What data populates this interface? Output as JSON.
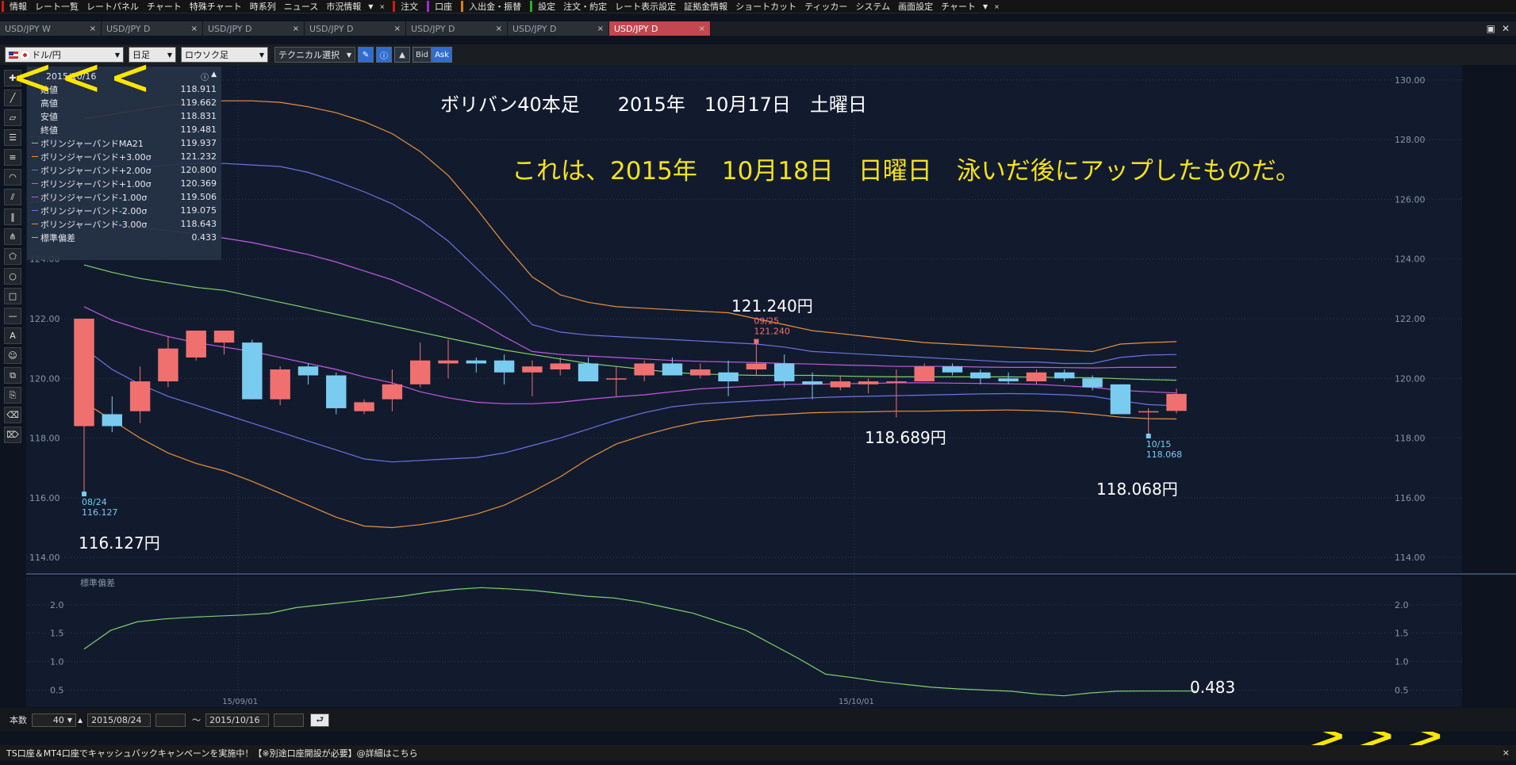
{
  "menubar": {
    "items": [
      "情報",
      "レート一覧",
      "レートパネル",
      "チャート",
      "特殊チャート",
      "時系列",
      "ニュース",
      "市況情報",
      "▼",
      "×",
      "注文",
      "口座",
      "入出金・振替",
      "設定",
      "注文・約定",
      "レート表示設定",
      "証拠金情報",
      "ショートカット",
      "ティッカー",
      "システム",
      "画面設定",
      "チャート",
      "▼",
      "×"
    ],
    "accent_colors": [
      "#d01a1a",
      "#9b2fd0",
      "#e07a1a",
      "#25b02a",
      "#e07a1a"
    ]
  },
  "tabs": [
    {
      "label": "USD/JPY W"
    },
    {
      "label": "USD/JPY D"
    },
    {
      "label": "USD/JPY D"
    },
    {
      "label": "USD/JPY D"
    },
    {
      "label": "USD/JPY D"
    },
    {
      "label": "USD/JPY D"
    },
    {
      "label": "USD/JPY D",
      "active": true
    }
  ],
  "tab_close": "×",
  "window_buttons": {
    "maximize": "▣",
    "close": "✕"
  },
  "toolbar": {
    "currency_pair": "ドル/円",
    "timeframe": "日足",
    "chart_type": "ロウソク足",
    "technical": "テクニカル選択",
    "bid": "Bid",
    "ask": "Ask"
  },
  "info_panel": {
    "date": "2015/10/16",
    "rows": [
      {
        "label": "始値",
        "value": "118.911"
      },
      {
        "label": "高値",
        "value": "119.662"
      },
      {
        "label": "安値",
        "value": "118.831"
      },
      {
        "label": "終値",
        "value": "119.481"
      },
      {
        "label": "ボリンジャーバンドMA21",
        "value": "119.937",
        "color": "#7ed16c"
      },
      {
        "label": "ボリンジャーバンド+3.00σ",
        "value": "121.232",
        "color": "#e8913a"
      },
      {
        "label": "ボリンジャーバンド+2.00σ",
        "value": "120.800",
        "color": "#6b74e0"
      },
      {
        "label": "ボリンジャーバンド+1.00σ",
        "value": "120.369",
        "color": "#c15be0"
      },
      {
        "label": "ボリンジャーバンド-1.00σ",
        "value": "119.506",
        "color": "#c15be0"
      },
      {
        "label": "ボリンジャーバンド-2.00σ",
        "value": "119.075",
        "color": "#6b74e0"
      },
      {
        "label": "ボリンジャーバンド-3.00σ",
        "value": "118.643",
        "color": "#e8913a"
      },
      {
        "label": "標準偏差",
        "value": "0.433",
        "color": "#7ed16c"
      }
    ]
  },
  "annotations": {
    "title": "ボリバン40本足　　2015年　10月17日　土曜日",
    "note": "これは、2015年　10月18日　日曜日　泳いだ後にアップしたものだ。",
    "high_label": "121.240円",
    "mid_low_label": "118.689円",
    "recent_low_label": "118.068円",
    "low_label": "116.127円",
    "std_label": "0.483",
    "left_arrows": "<<<",
    "right_arrows": ">>>"
  },
  "markers": {
    "high_date": "09/25",
    "high_value": "121.240",
    "low_date": "08/24",
    "low_value": "116.127",
    "recent_low_date": "10/15",
    "recent_low_value": "118.068"
  },
  "chart_data": [
    {
      "type": "candlestick",
      "ylim": [
        113.5,
        130.5
      ],
      "y_ticks": [
        "130.00",
        "128.00",
        "126.00",
        "124.00",
        "122.00",
        "120.00",
        "118.00",
        "116.00",
        "114.00"
      ],
      "x_tick_labels": [
        "15/09/01",
        "15/10/01"
      ],
      "candles": [
        {
          "o": 118.4,
          "h": 122.0,
          "l": 116.13,
          "c": 122.0
        },
        {
          "o": 118.8,
          "h": 119.4,
          "l": 118.2,
          "c": 118.4
        },
        {
          "o": 118.9,
          "h": 120.4,
          "l": 118.5,
          "c": 119.9
        },
        {
          "o": 119.9,
          "h": 121.4,
          "l": 119.7,
          "c": 121.0
        },
        {
          "o": 120.7,
          "h": 121.6,
          "l": 120.6,
          "c": 121.6
        },
        {
          "o": 121.2,
          "h": 121.6,
          "l": 120.8,
          "c": 121.6
        },
        {
          "o": 121.2,
          "h": 121.3,
          "l": 119.3,
          "c": 119.3
        },
        {
          "o": 119.3,
          "h": 120.4,
          "l": 119.1,
          "c": 120.3
        },
        {
          "o": 120.4,
          "h": 120.5,
          "l": 119.8,
          "c": 120.1
        },
        {
          "o": 120.1,
          "h": 120.2,
          "l": 118.8,
          "c": 119.0
        },
        {
          "o": 118.9,
          "h": 119.3,
          "l": 118.8,
          "c": 119.2
        },
        {
          "o": 119.3,
          "h": 120.3,
          "l": 118.9,
          "c": 119.8
        },
        {
          "o": 119.8,
          "h": 121.2,
          "l": 119.7,
          "c": 120.6
        },
        {
          "o": 120.5,
          "h": 121.3,
          "l": 120.0,
          "c": 120.6
        },
        {
          "o": 120.6,
          "h": 120.7,
          "l": 120.2,
          "c": 120.5
        },
        {
          "o": 120.6,
          "h": 120.8,
          "l": 119.8,
          "c": 120.2
        },
        {
          "o": 120.2,
          "h": 120.6,
          "l": 119.4,
          "c": 120.4
        },
        {
          "o": 120.3,
          "h": 120.7,
          "l": 120.1,
          "c": 120.5
        },
        {
          "o": 120.5,
          "h": 120.7,
          "l": 119.9,
          "c": 119.9
        },
        {
          "o": 120.0,
          "h": 120.4,
          "l": 119.4,
          "c": 120.0
        },
        {
          "o": 120.1,
          "h": 120.6,
          "l": 119.9,
          "c": 120.5
        },
        {
          "o": 120.5,
          "h": 120.7,
          "l": 120.2,
          "c": 120.1
        },
        {
          "o": 120.1,
          "h": 120.5,
          "l": 120.0,
          "c": 120.3
        },
        {
          "o": 120.2,
          "h": 120.6,
          "l": 119.4,
          "c": 119.9
        },
        {
          "o": 120.3,
          "h": 121.24,
          "l": 120.1,
          "c": 120.5
        },
        {
          "o": 120.5,
          "h": 120.8,
          "l": 119.7,
          "c": 119.9
        },
        {
          "o": 119.9,
          "h": 120.2,
          "l": 119.3,
          "c": 119.8
        },
        {
          "o": 119.7,
          "h": 120.1,
          "l": 119.6,
          "c": 119.9
        },
        {
          "o": 119.8,
          "h": 120.0,
          "l": 119.5,
          "c": 119.9
        },
        {
          "o": 119.9,
          "h": 120.3,
          "l": 118.69,
          "c": 119.9
        },
        {
          "o": 119.9,
          "h": 120.5,
          "l": 119.9,
          "c": 120.4
        },
        {
          "o": 120.4,
          "h": 120.5,
          "l": 120.1,
          "c": 120.2
        },
        {
          "o": 120.2,
          "h": 120.3,
          "l": 119.8,
          "c": 120.0
        },
        {
          "o": 120.0,
          "h": 120.2,
          "l": 119.8,
          "c": 119.9
        },
        {
          "o": 119.9,
          "h": 120.3,
          "l": 119.8,
          "c": 120.2
        },
        {
          "o": 120.2,
          "h": 120.3,
          "l": 119.9,
          "c": 120.0
        },
        {
          "o": 120.0,
          "h": 120.1,
          "l": 119.6,
          "c": 119.7
        },
        {
          "o": 119.8,
          "h": 119.8,
          "l": 118.8,
          "c": 118.8
        },
        {
          "o": 118.9,
          "h": 119.0,
          "l": 118.07,
          "c": 118.9
        },
        {
          "o": 118.91,
          "h": 119.66,
          "l": 118.83,
          "c": 119.48
        }
      ],
      "bands": {
        "ma21": [
          123.8,
          123.55,
          123.35,
          123.2,
          123.05,
          122.95,
          122.75,
          122.55,
          122.35,
          122.15,
          121.95,
          121.75,
          121.55,
          121.35,
          121.15,
          120.95,
          120.8,
          120.65,
          120.5,
          120.4,
          120.3,
          120.2,
          120.15,
          120.12,
          120.1,
          120.1,
          120.1,
          120.08,
          120.06,
          120.05,
          120.05,
          120.05,
          120.05,
          120.05,
          120.04,
          120.03,
          120.02,
          119.99,
          119.96,
          119.94
        ],
        "p3": [
          128.7,
          128.85,
          129.0,
          129.15,
          129.25,
          129.3,
          129.3,
          129.25,
          129.1,
          128.9,
          128.6,
          128.2,
          127.6,
          126.8,
          125.7,
          124.5,
          123.4,
          122.8,
          122.55,
          122.4,
          122.35,
          122.3,
          122.25,
          122.2,
          122.0,
          121.8,
          121.6,
          121.5,
          121.4,
          121.3,
          121.2,
          121.15,
          121.1,
          121.05,
          121.0,
          120.95,
          120.9,
          121.15,
          121.2,
          121.23
        ],
        "p2": [
          126.85,
          126.95,
          127.05,
          127.15,
          127.2,
          127.2,
          127.15,
          127.1,
          126.9,
          126.6,
          126.25,
          125.85,
          125.3,
          124.6,
          123.7,
          122.8,
          121.8,
          121.55,
          121.45,
          121.4,
          121.35,
          121.3,
          121.25,
          121.2,
          121.15,
          121.05,
          120.9,
          120.85,
          120.8,
          120.75,
          120.7,
          120.65,
          120.6,
          120.55,
          120.55,
          120.5,
          120.5,
          120.7,
          120.78,
          120.8
        ],
        "p1": [
          125.25,
          125.15,
          125.05,
          124.95,
          124.85,
          124.7,
          124.55,
          124.35,
          124.15,
          123.9,
          123.6,
          123.3,
          122.9,
          122.45,
          121.95,
          121.4,
          120.9,
          120.8,
          120.75,
          120.7,
          120.65,
          120.6,
          120.57,
          120.55,
          120.53,
          120.5,
          120.48,
          120.45,
          120.43,
          120.4,
          120.4,
          120.4,
          120.38,
          120.37,
          120.37,
          120.36,
          120.35,
          120.37,
          120.37,
          120.37
        ],
        "m1": [
          122.4,
          121.95,
          121.65,
          121.4,
          121.2,
          121.05,
          120.9,
          120.7,
          120.5,
          120.3,
          120.05,
          119.85,
          119.55,
          119.35,
          119.2,
          119.15,
          119.15,
          119.2,
          119.3,
          119.38,
          119.45,
          119.55,
          119.65,
          119.7,
          119.75,
          119.8,
          119.8,
          119.82,
          119.83,
          119.85,
          119.85,
          119.84,
          119.83,
          119.82,
          119.8,
          119.75,
          119.7,
          119.6,
          119.55,
          119.51
        ],
        "m2": [
          121.0,
          120.3,
          119.8,
          119.4,
          119.1,
          118.8,
          118.5,
          118.2,
          117.9,
          117.6,
          117.3,
          117.2,
          117.25,
          117.3,
          117.35,
          117.5,
          117.75,
          118.0,
          118.3,
          118.6,
          118.85,
          119.05,
          119.15,
          119.2,
          119.25,
          119.3,
          119.35,
          119.38,
          119.4,
          119.42,
          119.44,
          119.46,
          119.48,
          119.49,
          119.48,
          119.45,
          119.4,
          119.25,
          119.12,
          119.08
        ],
        "m3": [
          119.2,
          118.6,
          118.0,
          117.5,
          117.15,
          116.9,
          116.55,
          116.15,
          115.75,
          115.35,
          115.05,
          115.0,
          115.1,
          115.25,
          115.45,
          115.75,
          116.2,
          116.7,
          117.3,
          117.8,
          118.1,
          118.35,
          118.55,
          118.65,
          118.75,
          118.8,
          118.85,
          118.87,
          118.88,
          118.9,
          118.9,
          118.92,
          118.93,
          118.94,
          118.92,
          118.88,
          118.8,
          118.7,
          118.65,
          118.64
        ]
      }
    },
    {
      "type": "line",
      "title": "標準偏差",
      "ylim": [
        0.2,
        2.5
      ],
      "y_ticks": [
        "2.0",
        "1.5",
        "1.0",
        "0.5"
      ],
      "values": [
        1.22,
        1.55,
        1.7,
        1.75,
        1.78,
        1.8,
        1.82,
        1.85,
        1.95,
        2.0,
        2.05,
        2.1,
        2.15,
        2.22,
        2.27,
        2.3,
        2.28,
        2.25,
        2.2,
        2.15,
        2.12,
        2.05,
        1.95,
        1.85,
        1.7,
        1.55,
        1.3,
        1.05,
        0.78,
        0.72,
        0.65,
        0.6,
        0.55,
        0.52,
        0.5,
        0.48,
        0.43,
        0.4,
        0.45,
        0.48,
        0.483,
        0.483,
        0.483
      ]
    }
  ],
  "bottom": {
    "count_label": "本数",
    "count_value": "40",
    "start_date": "2015/08/24",
    "tilde": "～",
    "end_date": "2015/10/16",
    "status": "TS口座＆MT4口座でキャッシュバックキャンペーンを実施中！【※別途口座開設が必要】@詳細はこちら",
    "status_close": "×"
  },
  "colors": {
    "up": "#f07070",
    "down": "#79ccf0",
    "bg": "#121b2e",
    "grid": "#2a3a55",
    "highlight": "#f0e010"
  }
}
